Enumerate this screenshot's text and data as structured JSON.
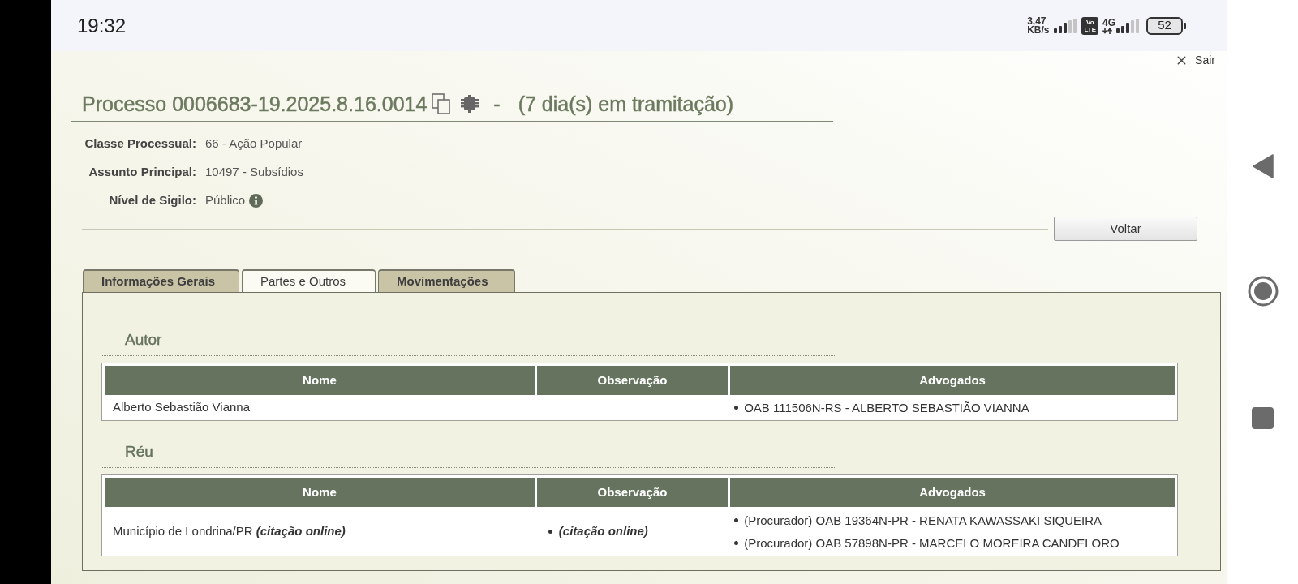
{
  "status_bar": {
    "time": "19:32",
    "data_rate": [
      "3,47",
      "KB/s"
    ],
    "volte": [
      "Vo",
      "LTE"
    ],
    "network": "4G",
    "battery": "52"
  },
  "exit_link": "Sair",
  "process": {
    "title": "Processo 0006683-19.2025.8.16.0014",
    "separator": "-",
    "duration": "(7 dia(s) em tramitação)",
    "fields": [
      {
        "label": "Classe Processual:",
        "value": "66 - Ação Popular",
        "has_info": false
      },
      {
        "label": "Assunto Principal:",
        "value": "10497 - Subsídios",
        "has_info": false
      },
      {
        "label": "Nível de Sigilo:",
        "value": "Público",
        "has_info": true
      }
    ]
  },
  "back_button": "Voltar",
  "tabs": [
    {
      "label": "Informações Gerais",
      "selected": false
    },
    {
      "label": "Partes e Outros",
      "selected": true
    },
    {
      "label": "Movimentações",
      "selected": false
    }
  ],
  "sections": [
    {
      "title": "Autor",
      "columns": [
        "Nome",
        "Observação",
        "Advogados"
      ],
      "rows": [
        {
          "name": "Alberto Sebastião Vianna",
          "lawyers": [
            "OAB 111506N-RS - ALBERTO SEBASTIÃO VIANNA"
          ]
        }
      ]
    },
    {
      "title": "Réu",
      "columns": [
        "Nome",
        "Observação",
        "Advogados"
      ],
      "rows": [
        {
          "name": "Município de Londrina/PR *(citação online)*",
          "observations": [
            "(citação online)"
          ],
          "lawyers": [
            "(Procurador) OAB 19364N-PR - RENATA KAWASSAKI SIQUEIRA",
            "(Procurador) OAB 57898N-PR - MARCELO MOREIRA CANDELORO"
          ]
        }
      ]
    }
  ]
}
